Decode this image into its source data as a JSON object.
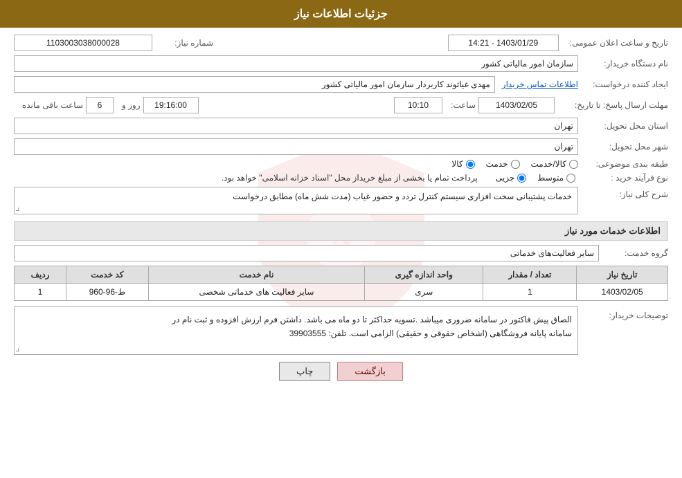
{
  "header": {
    "title": "جزئیات اطلاعات نیاز"
  },
  "fields": {
    "shomara_niaz_label": "شماره نیاز:",
    "shomara_niaz_value": "1103003038000028",
    "nam_dastgah_label": "نام دستگاه خریدار:",
    "nam_dastgah_value": "سازمان امور مالیاتی کشور",
    "ijad_konande_label": "ایجاد کننده درخواست:",
    "ijad_konande_value": "مهدی غیاثوند کاربردار سازمان امور مالیاتی کشور",
    "info_link_text": "اطلاعات تماس خریدار",
    "mohlat_label": "مهلت ارسال پاسخ: تا تاریخ:",
    "date_value": "1403/02/05",
    "time_label": "ساعت:",
    "time_value": "10:10",
    "roz_label": "روز و",
    "roz_value": "6",
    "baqi_label": "ساعت باقی مانده",
    "remaining_value": "19:16:00",
    "date_announce_label": "تاریخ و ساعت اعلان عمومی:",
    "date_announce_value": "1403/01/29 - 14:21",
    "ostan_label": "استان محل تحویل:",
    "ostan_value": "تهران",
    "shahr_label": "شهر محل تحویل:",
    "shahr_value": "تهران",
    "tabaqe_label": "طبقه بندی موضوعی:",
    "tabaqe_kala": "کالا",
    "tabaqe_khedmat": "خدمت",
    "tabaqe_kala_khedmat": "کالا/خدمت",
    "purchase_label": "نوع فرآیند خرید :",
    "purchase_jozei": "جزیی",
    "purchase_motevaset": "متوسط",
    "purchase_desc": "پرداخت تمام یا بخشی از مبلغ خریداز محل \"اسناد خزانه اسلامی\" خواهد بود.",
    "sharh_label": "شرح کلی نیاز:",
    "sharh_value": "خدمات پشتیبانی سخت افزاری سیستم کنترل تردد و حضور غیاب (مدت شش ماه) مطابق درخواست",
    "services_section_title": "اطلاعات خدمات مورد نیاز",
    "group_label": "گروه خدمت:",
    "group_value": "سایر فعالیت‌های خدماتی",
    "table": {
      "headers": [
        "ردیف",
        "کد خدمت",
        "نام خدمت",
        "واحد اندازه گیری",
        "تعداد / مقدار",
        "تاریخ نیاز"
      ],
      "rows": [
        {
          "radif": "1",
          "kod": "ط-96-960",
          "nam": "سایر فعالیت های خدماتی شخصی",
          "vahed": "سری",
          "tedad": "1",
          "tarikh": "1403/02/05"
        }
      ]
    },
    "buyer_notes_label": "توصیحات خریدار:",
    "buyer_notes_line1": "الصاق پیش فاکتور در سامانه ضروری میباشد .تسویه حداکثر تا دو ماه می باشد.  داشتن فرم ارزش افزوده و ثبت نام در",
    "buyer_notes_line2": "سامانه پایانه فروشگاهی (اشخاص حقوقی و حقیقی) الزامی است. تلفن:  39903555"
  },
  "buttons": {
    "print": "چاپ",
    "back": "بازگشت"
  }
}
